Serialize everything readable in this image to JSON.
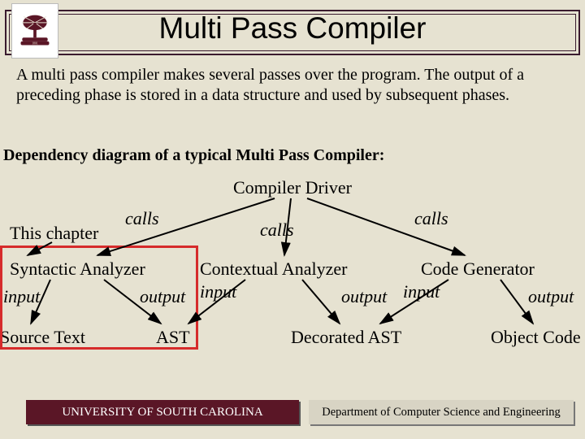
{
  "title": "Multi Pass Compiler",
  "body": "A multi pass compiler makes several passes over the program. The output of a preceding phase is stored in a data structure and used by subsequent phases.",
  "dep_heading": "Dependency diagram of a typical Multi Pass Compiler:",
  "driver": "Compiler Driver",
  "calls_left": "calls",
  "calls_mid": "calls",
  "calls_right": "calls",
  "this_chapter": "This chapter",
  "syntactic": "Syntactic Analyzer",
  "contextual": "Contextual Analyzer",
  "codegen": "Code Generator",
  "input1": "input",
  "output1": "output",
  "input2": "input",
  "output2": "output",
  "input3": "input",
  "output3": "output",
  "source": "Source Text",
  "ast": "AST",
  "dast": "Decorated AST",
  "objcode": "Object Code",
  "footer_left": "UNIVERSITY OF SOUTH CAROLINA",
  "footer_right": "Department of Computer Science and Engineering"
}
